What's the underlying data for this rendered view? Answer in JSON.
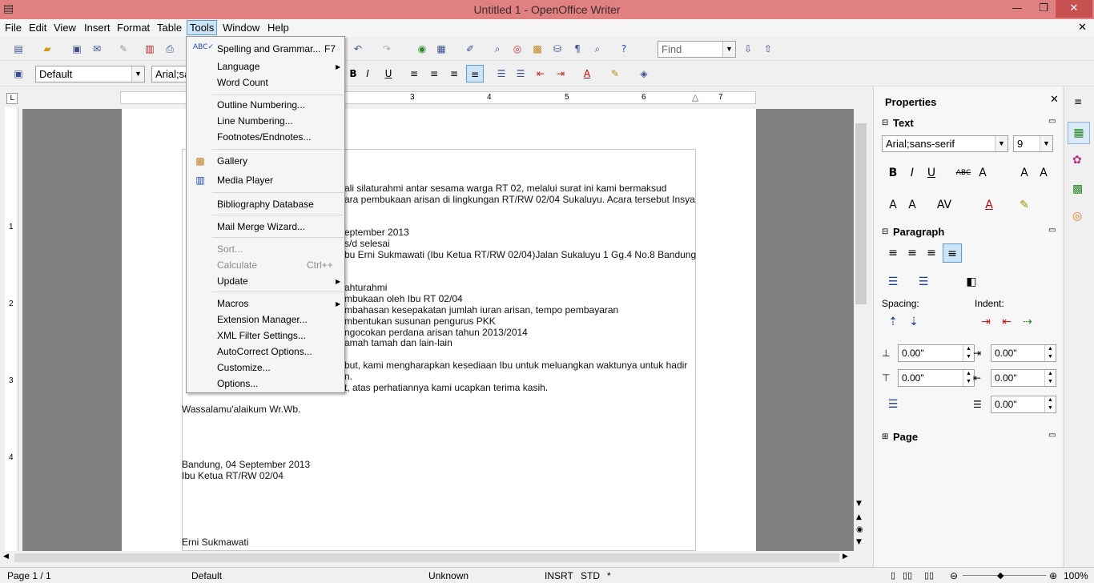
{
  "window": {
    "title": "Untitled 1 - OpenOffice Writer"
  },
  "menubar": {
    "items": [
      "File",
      "Edit",
      "View",
      "Insert",
      "Format",
      "Table",
      "Tools",
      "Window",
      "Help"
    ]
  },
  "toolbar": {
    "find_placeholder": "Find",
    "paragraph_style": "Default",
    "font_name": "Arial;sa"
  },
  "tools_menu": {
    "items": [
      {
        "label": "Spelling and Grammar...",
        "shortcut": "F7"
      },
      {
        "label": "Language",
        "submenu": true
      },
      {
        "label": "Word Count"
      },
      {
        "label": "Outline Numbering..."
      },
      {
        "label": "Line Numbering..."
      },
      {
        "label": "Footnotes/Endnotes..."
      },
      {
        "label": "Gallery"
      },
      {
        "label": "Media Player"
      },
      {
        "label": "Bibliography Database"
      },
      {
        "label": "Mail Merge Wizard..."
      },
      {
        "label": "Sort...",
        "disabled": true
      },
      {
        "label": "Calculate",
        "shortcut": "Ctrl++",
        "disabled": true
      },
      {
        "label": "Update",
        "submenu": true
      },
      {
        "label": "Macros",
        "submenu": true
      },
      {
        "label": "Extension Manager..."
      },
      {
        "label": "XML Filter Settings..."
      },
      {
        "label": "AutoCorrect Options..."
      },
      {
        "label": "Customize..."
      },
      {
        "label": "Options..."
      }
    ]
  },
  "ruler": {
    "ticks": [
      "3",
      "4",
      "5",
      "6",
      "7"
    ]
  },
  "vruler": {
    "ticks": [
      "1",
      "2",
      "3",
      "4"
    ]
  },
  "document": {
    "lines": [
      "ali silaturahmi antar sesama warga RT 02, melalui surat ini kami bermaksud",
      "ara pembukaan arisan di lingkungan RT/RW 02/04 Sukaluyu. Acara tersebut Insya",
      "eptember 2013",
      "s/d selesai",
      "bu Erni Sukmawati (Ibu Ketua RT/RW 02/04)Jalan Sukaluyu 1 Gg.4 No.8 Bandung",
      "ahturahmi",
      "mbukaan oleh Ibu RT 02/04",
      "mbahasan kesepakatan jumlah iuran arisan, tempo pembayaran",
      "mbentukan susunan pengurus PKK",
      "ngocokan perdana arisan tahun 2013/2014",
      "amah tamah dan lain-lain",
      "but, kami mengharapkan kesediaan Ibu untuk meluangkan waktunya untuk hadir",
      "n.",
      "t, atas perhatiannya kami ucapkan terima kasih.",
      "Wassalamu'alaikum Wr.Wb.",
      "Bandung, 04 September 2013",
      "Ibu Ketua RT/RW 02/04",
      "Erni Sukmawati"
    ]
  },
  "sidebar": {
    "title": "Properties",
    "text_section": "Text",
    "font_name": "Arial;sans-serif",
    "font_size": "9",
    "paragraph_section": "Paragraph",
    "spacing_label": "Spacing:",
    "indent_label": "Indent:",
    "spacing_above": "0.00\"",
    "spacing_below": "0.00\"",
    "indent_before": "0.00\"",
    "indent_after": "0.00\"",
    "first_line": "0.00\"",
    "page_section": "Page"
  },
  "statusbar": {
    "page": "Page 1 / 1",
    "style": "Default",
    "language": "Unknown",
    "insert_mode": "INSRT",
    "selection_mode": "STD",
    "modified": "*",
    "zoom": "100%"
  }
}
